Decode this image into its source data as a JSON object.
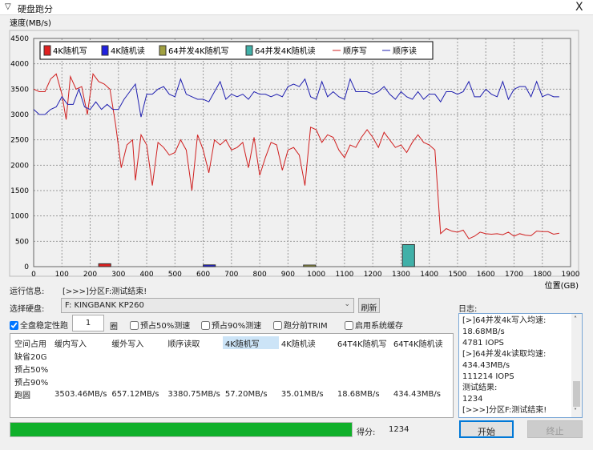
{
  "window": {
    "title": "硬盘跑分",
    "close": "X"
  },
  "chart_data": {
    "type": "line",
    "ylabel": "速度(MB/s)",
    "xlabel": "位置(GB)",
    "xlim": [
      0,
      1900
    ],
    "ylim": [
      0,
      4500
    ],
    "xticks": [
      0,
      100,
      200,
      300,
      400,
      500,
      600,
      700,
      800,
      900,
      1000,
      1100,
      1200,
      1300,
      1400,
      1500,
      1600,
      1700,
      1800,
      1900
    ],
    "yticks": [
      0,
      500,
      1000,
      1500,
      2000,
      2500,
      3000,
      3500,
      4000,
      4500
    ],
    "grid": true,
    "legend_position": "top-left",
    "bars": [
      {
        "name": "4K随机写",
        "x": [
          230,
          273
        ],
        "value": 57.2,
        "color": "#e02020"
      },
      {
        "name": "4K随机读",
        "x": [
          600,
          643
        ],
        "value": 35.01,
        "color": "#2020e0"
      },
      {
        "name": "64并发4K随机写",
        "x": [
          955,
          998
        ],
        "value": 18.68,
        "color": "#a0a040"
      },
      {
        "name": "64并发4K随机读",
        "x": [
          1305,
          1348
        ],
        "value": 434.43,
        "color": "#40b0a8"
      }
    ],
    "series": [
      {
        "name": "顺序写",
        "color": "#d02020",
        "x": [
          0,
          20,
          40,
          60,
          80,
          100,
          115,
          130,
          150,
          170,
          190,
          210,
          230,
          250,
          270,
          290,
          310,
          330,
          350,
          360,
          380,
          400,
          420,
          440,
          460,
          480,
          500,
          520,
          540,
          560,
          580,
          600,
          620,
          640,
          660,
          680,
          700,
          720,
          740,
          760,
          780,
          800,
          820,
          840,
          860,
          880,
          900,
          920,
          940,
          960,
          980,
          1000,
          1020,
          1040,
          1060,
          1080,
          1100,
          1120,
          1140,
          1160,
          1180,
          1200,
          1220,
          1240,
          1260,
          1280,
          1300,
          1320,
          1340,
          1360,
          1380,
          1400,
          1420,
          1440,
          1460,
          1480,
          1500,
          1520,
          1540,
          1560,
          1580,
          1600,
          1620,
          1640,
          1660,
          1680,
          1700,
          1720,
          1740,
          1760,
          1780,
          1800,
          1820,
          1840,
          1860
        ],
        "y": [
          3500,
          3450,
          3450,
          3700,
          3800,
          3400,
          2900,
          3750,
          3500,
          3550,
          3000,
          3800,
          3650,
          3600,
          3500,
          2800,
          1950,
          2400,
          2500,
          1700,
          2600,
          2400,
          1600,
          2450,
          2350,
          2200,
          2250,
          2500,
          2300,
          1500,
          2600,
          2300,
          1850,
          2500,
          2400,
          2500,
          2300,
          2350,
          2450,
          1950,
          2550,
          1800,
          2150,
          2450,
          2400,
          1900,
          2300,
          2350,
          2200,
          1600,
          2750,
          2700,
          2450,
          2600,
          2550,
          2300,
          2150,
          2400,
          2350,
          2550,
          2700,
          2550,
          2350,
          2650,
          2500,
          2350,
          2400,
          2250,
          2450,
          2600,
          2450,
          2400,
          2300,
          650,
          750,
          700,
          680,
          720,
          550,
          600,
          680,
          650,
          640,
          650,
          630,
          680,
          600,
          650,
          620,
          610,
          700,
          690,
          690,
          640,
          660
        ]
      },
      {
        "name": "顺序读",
        "color": "#2020b0",
        "x": [
          0,
          20,
          40,
          60,
          80,
          100,
          120,
          140,
          160,
          180,
          200,
          220,
          240,
          260,
          280,
          300,
          320,
          340,
          360,
          380,
          400,
          420,
          440,
          460,
          480,
          500,
          520,
          540,
          560,
          580,
          600,
          620,
          640,
          660,
          680,
          700,
          720,
          740,
          760,
          780,
          800,
          820,
          840,
          860,
          880,
          900,
          920,
          940,
          960,
          980,
          1000,
          1020,
          1040,
          1060,
          1080,
          1100,
          1120,
          1140,
          1160,
          1180,
          1200,
          1220,
          1240,
          1260,
          1280,
          1300,
          1320,
          1340,
          1360,
          1380,
          1400,
          1420,
          1440,
          1460,
          1480,
          1500,
          1520,
          1540,
          1560,
          1580,
          1600,
          1620,
          1640,
          1660,
          1680,
          1700,
          1720,
          1740,
          1760,
          1780,
          1800,
          1820,
          1840,
          1860
        ],
        "y": [
          3100,
          3000,
          3000,
          3100,
          3150,
          3350,
          3200,
          3200,
          3500,
          3150,
          3100,
          3250,
          3100,
          3200,
          3100,
          3100,
          3300,
          3450,
          3600,
          2950,
          3400,
          3400,
          3500,
          3550,
          3400,
          3350,
          3700,
          3400,
          3350,
          3300,
          3300,
          3250,
          3450,
          3650,
          3300,
          3400,
          3350,
          3400,
          3300,
          3450,
          3400,
          3400,
          3350,
          3400,
          3350,
          3550,
          3600,
          3550,
          3700,
          3350,
          3300,
          3650,
          3350,
          3450,
          3350,
          3300,
          3700,
          3450,
          3450,
          3450,
          3400,
          3450,
          3550,
          3400,
          3300,
          3450,
          3350,
          3300,
          3450,
          3300,
          3400,
          3400,
          3250,
          3450,
          3450,
          3400,
          3450,
          3650,
          3350,
          3350,
          3500,
          3400,
          3350,
          3650,
          3300,
          3500,
          3550,
          3550,
          3350,
          3650,
          3350,
          3400,
          3350,
          3350
        ]
      }
    ]
  },
  "run_info": {
    "label": "运行信息:",
    "value": "[>>>]分区F:测试结束!"
  },
  "disk": {
    "label": "选择硬盘:",
    "value": "F: KINGBANK KP260",
    "refresh": "刷新"
  },
  "options": {
    "full_disk": "全盘稳定性跑",
    "rounds": "1",
    "rounds_unit": "圈",
    "pre50": "预占50%测速",
    "pre90": "预占90%测速",
    "trim": "跑分前TRIM",
    "cache": "启用系统缓存"
  },
  "table": {
    "headers": [
      "空间占用",
      "缓内写入",
      "缓外写入",
      "顺序读取",
      "4K随机写",
      "4K随机读",
      "64T4K随机写",
      "64T4K随机读"
    ],
    "rows": [
      [
        "缺省20G",
        "",
        "",
        "",
        "",
        "",
        "",
        ""
      ],
      [
        "预占50%",
        "",
        "",
        "",
        "",
        "",
        "",
        ""
      ],
      [
        "预占90%",
        "",
        "",
        "",
        "",
        "",
        "",
        ""
      ],
      [
        "跑圆",
        "3503.46MB/s",
        "657.12MB/s",
        "3380.75MB/s",
        "57.20MB/s",
        "35.01MB/s",
        "18.68MB/s",
        "434.43MB/s"
      ]
    ]
  },
  "log": {
    "label": "日志:",
    "lines": [
      "[>]64并发4k写入均速:",
      "18.68MB/s",
      "4781 IOPS",
      "[>]64并发4k读取均速:",
      "434.43MB/s",
      "111214 IOPS",
      "测试结果:",
      "1234",
      "[>>>]分区F:测试结束!"
    ]
  },
  "progress": {
    "percent": 100,
    "color": "#10b02a"
  },
  "score": {
    "label": "得分:",
    "value": "1234"
  },
  "buttons": {
    "start": "开始",
    "stop": "终止"
  }
}
